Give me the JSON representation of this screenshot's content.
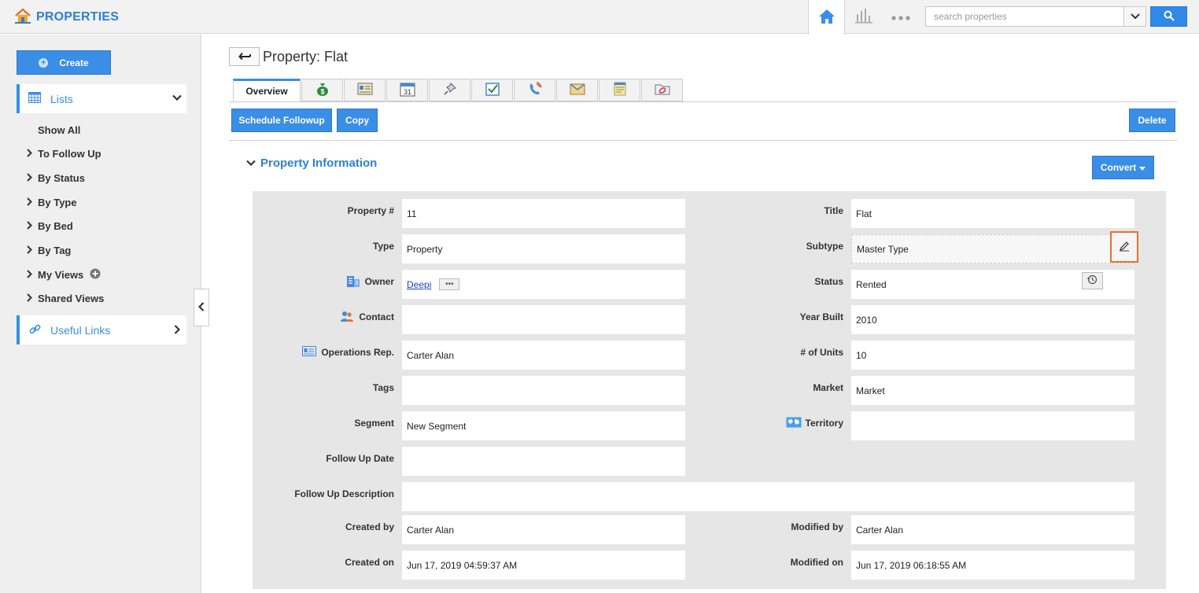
{
  "app": {
    "title": "PROPERTIES"
  },
  "search": {
    "placeholder": "search properties"
  },
  "sidebar": {
    "create_label": "Create",
    "lists_label": "Lists",
    "items": [
      "Show All",
      "To Follow Up",
      "By Status",
      "By Type",
      "By Bed",
      "By Tag",
      "My Views",
      "Shared Views"
    ],
    "useful_links_label": "Useful Links"
  },
  "page": {
    "title": "Property: Flat"
  },
  "tabs": {
    "overview": "Overview"
  },
  "actions": {
    "schedule_followup": "Schedule Followup",
    "copy": "Copy",
    "delete": "Delete",
    "convert": "Convert"
  },
  "section": {
    "title": "Property Information"
  },
  "fields": {
    "property_no": {
      "label": "Property #",
      "value": "11"
    },
    "title": {
      "label": "Title",
      "value": "Flat"
    },
    "type": {
      "label": "Type",
      "value": "Property"
    },
    "subtype": {
      "label": "Subtype",
      "value": "Master Type"
    },
    "owner": {
      "label": "Owner",
      "value": "Deepi"
    },
    "status": {
      "label": "Status",
      "value": "Rented"
    },
    "contact": {
      "label": "Contact",
      "value": ""
    },
    "year_built": {
      "label": "Year Built",
      "value": "2010"
    },
    "operations_rep": {
      "label": "Operations Rep.",
      "value": "Carter Alan"
    },
    "units": {
      "label": "# of Units",
      "value": "10"
    },
    "tags": {
      "label": "Tags",
      "value": ""
    },
    "market": {
      "label": "Market",
      "value": "Market"
    },
    "segment": {
      "label": "Segment",
      "value": "New Segment"
    },
    "territory": {
      "label": "Territory",
      "value": ""
    },
    "followup_date": {
      "label": "Follow Up Date",
      "value": ""
    },
    "followup_desc": {
      "label": "Follow Up Description",
      "value": ""
    },
    "created_by": {
      "label": "Created by",
      "value": "Carter Alan"
    },
    "modified_by": {
      "label": "Modified by",
      "value": "Carter Alan"
    },
    "created_on": {
      "label": "Created on",
      "value": "Jun 17, 2019 04:59:37 AM"
    },
    "modified_on": {
      "label": "Modified on",
      "value": "Jun 17, 2019 06:18:55 AM"
    }
  },
  "colors": {
    "accent": "#3a8ee6",
    "highlight": "#e8712a"
  }
}
